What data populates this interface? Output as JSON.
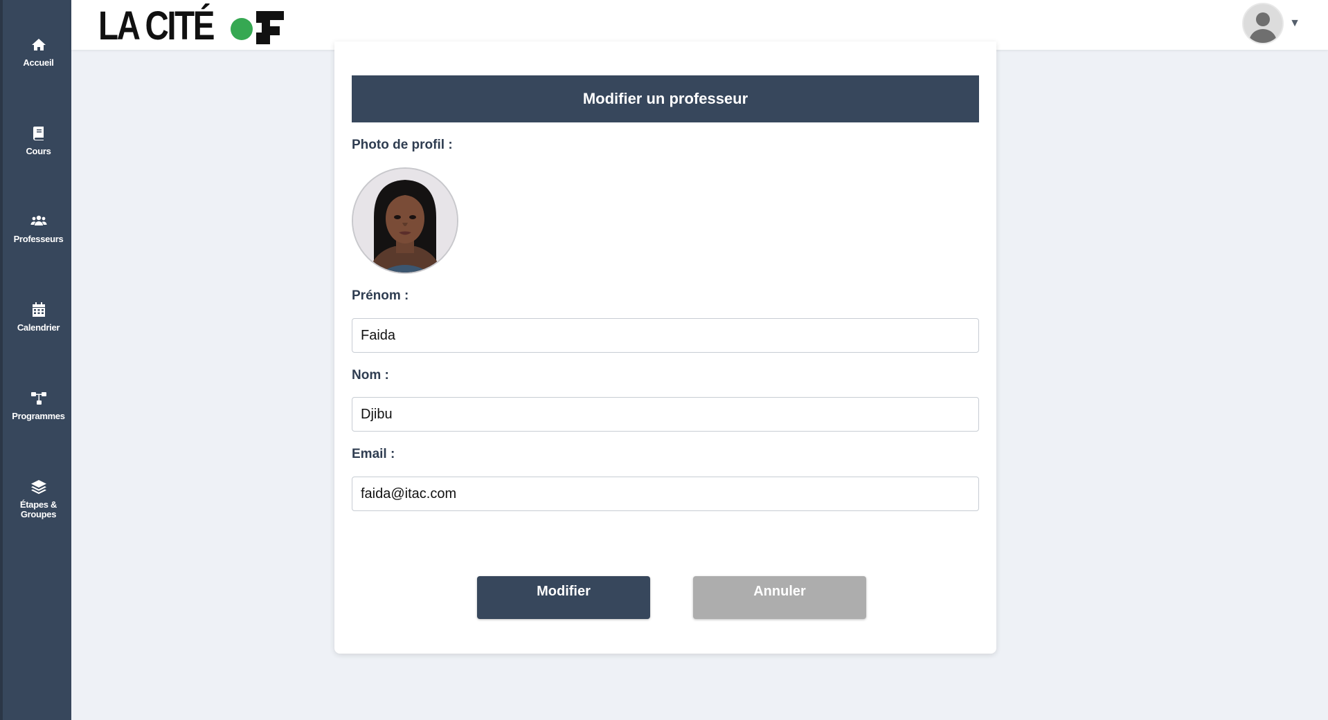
{
  "sidebar": {
    "items": [
      {
        "label": "Accueil",
        "icon": "home-icon"
      },
      {
        "label": "Cours",
        "icon": "book-icon"
      },
      {
        "label": "Professeurs",
        "icon": "users-icon"
      },
      {
        "label": "Calendrier",
        "icon": "calendar-icon"
      },
      {
        "label": "Programmes",
        "icon": "sitemap-icon"
      },
      {
        "label": "Étapes & Groupes",
        "icon": "layers-icon"
      }
    ]
  },
  "header": {
    "logo_text": "LA CITÉ",
    "logo_dot_color": "#36a852",
    "user_menu_icon": "user-avatar-icon",
    "caret": "▼"
  },
  "form": {
    "title": "Modifier un professeur",
    "photo_label": "Photo de profil :",
    "prenom_label": "Prénom :",
    "prenom_value": "Faida",
    "nom_label": "Nom :",
    "nom_value": "Djibu",
    "email_label": "Email :",
    "email_value": "faida@itac.com",
    "submit_label": "Modifier",
    "cancel_label": "Annuler"
  },
  "colors": {
    "sidebar": "#37475c",
    "primary": "#37475c",
    "cancel": "#adadad",
    "background": "#eef1f6"
  }
}
